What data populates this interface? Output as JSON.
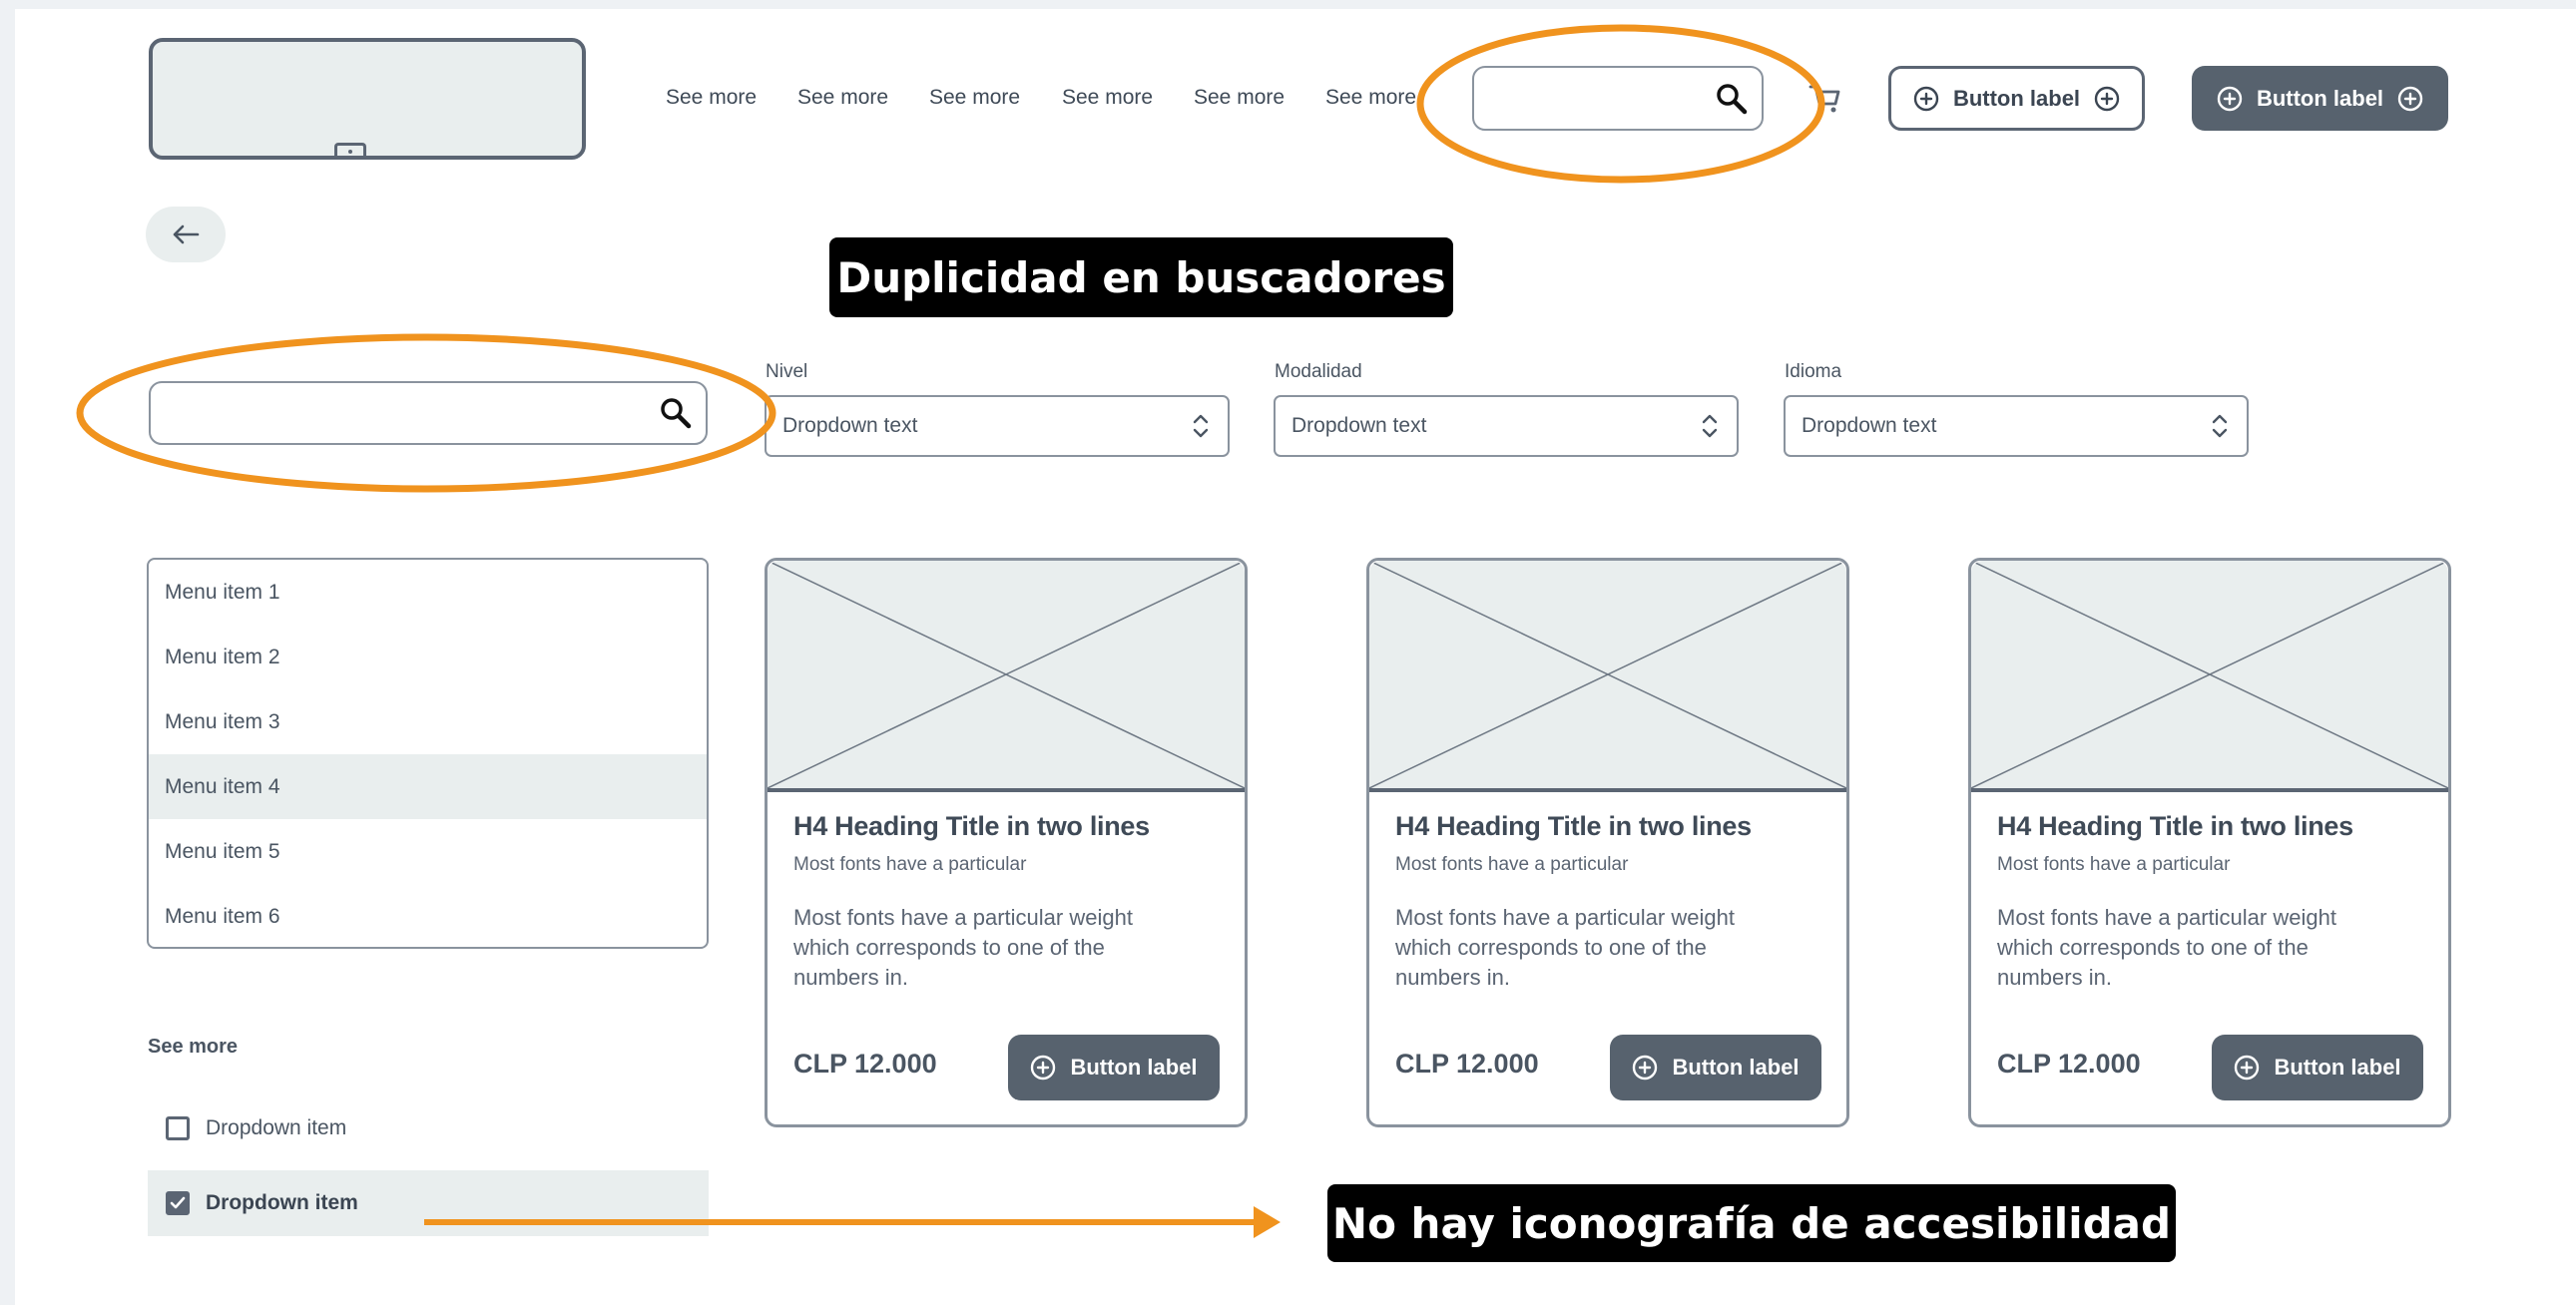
{
  "header": {
    "nav_links": [
      "See more",
      "See more",
      "See more",
      "See more",
      "See more",
      "See more"
    ],
    "search_placeholder": "",
    "outline_button_label": "Button label",
    "solid_button_label": "Button label"
  },
  "filters": {
    "search_placeholder": "",
    "dropdowns": [
      {
        "label": "Nivel",
        "value": "Dropdown text"
      },
      {
        "label": "Modalidad",
        "value": "Dropdown text"
      },
      {
        "label": "Idioma",
        "value": "Dropdown text"
      }
    ]
  },
  "sidebar": {
    "menu_items": [
      "Menu item 1",
      "Menu item 2",
      "Menu item 3",
      "Menu item 4",
      "Menu item 5",
      "Menu item 6"
    ],
    "active_menu_item": "Menu item 4",
    "see_more": "See more",
    "checkbox_items": [
      {
        "label": "Dropdown item",
        "checked": false
      },
      {
        "label": "Dropdown item",
        "checked": true
      }
    ]
  },
  "cards": [
    {
      "title": "H4 Heading Title in two lines",
      "subtitle": "Most fonts have a particular",
      "body": "Most fonts have a particular weight which corresponds to one of the numbers in.",
      "price": "CLP 12.000",
      "button_label": "Button label"
    },
    {
      "title": "H4 Heading Title in two lines",
      "subtitle": "Most fonts have a particular",
      "body": "Most fonts have a particular weight which corresponds to one of the numbers in.",
      "price": "CLP 12.000",
      "button_label": "Button label"
    },
    {
      "title": "H4 Heading Title in two lines",
      "subtitle": "Most fonts have a particular",
      "body": "Most fonts have a particular weight which corresponds to one of the numbers in.",
      "price": "CLP 12.000",
      "button_label": "Button label"
    }
  ],
  "annotations": {
    "duplicate_search_note": "Duplicidad en buscadores",
    "accessibility_note": "No hay iconografía de accesibilidad"
  },
  "colors": {
    "accent_annotation": "#f0931e",
    "primary_button": "#57626e",
    "muted_fill": "#e9eeee",
    "border": "#8a939e"
  },
  "icons": [
    "search-icon",
    "cart-icon",
    "plus-circle-icon",
    "back-arrow-icon",
    "chevron-updown-icon",
    "checkmark-icon"
  ]
}
